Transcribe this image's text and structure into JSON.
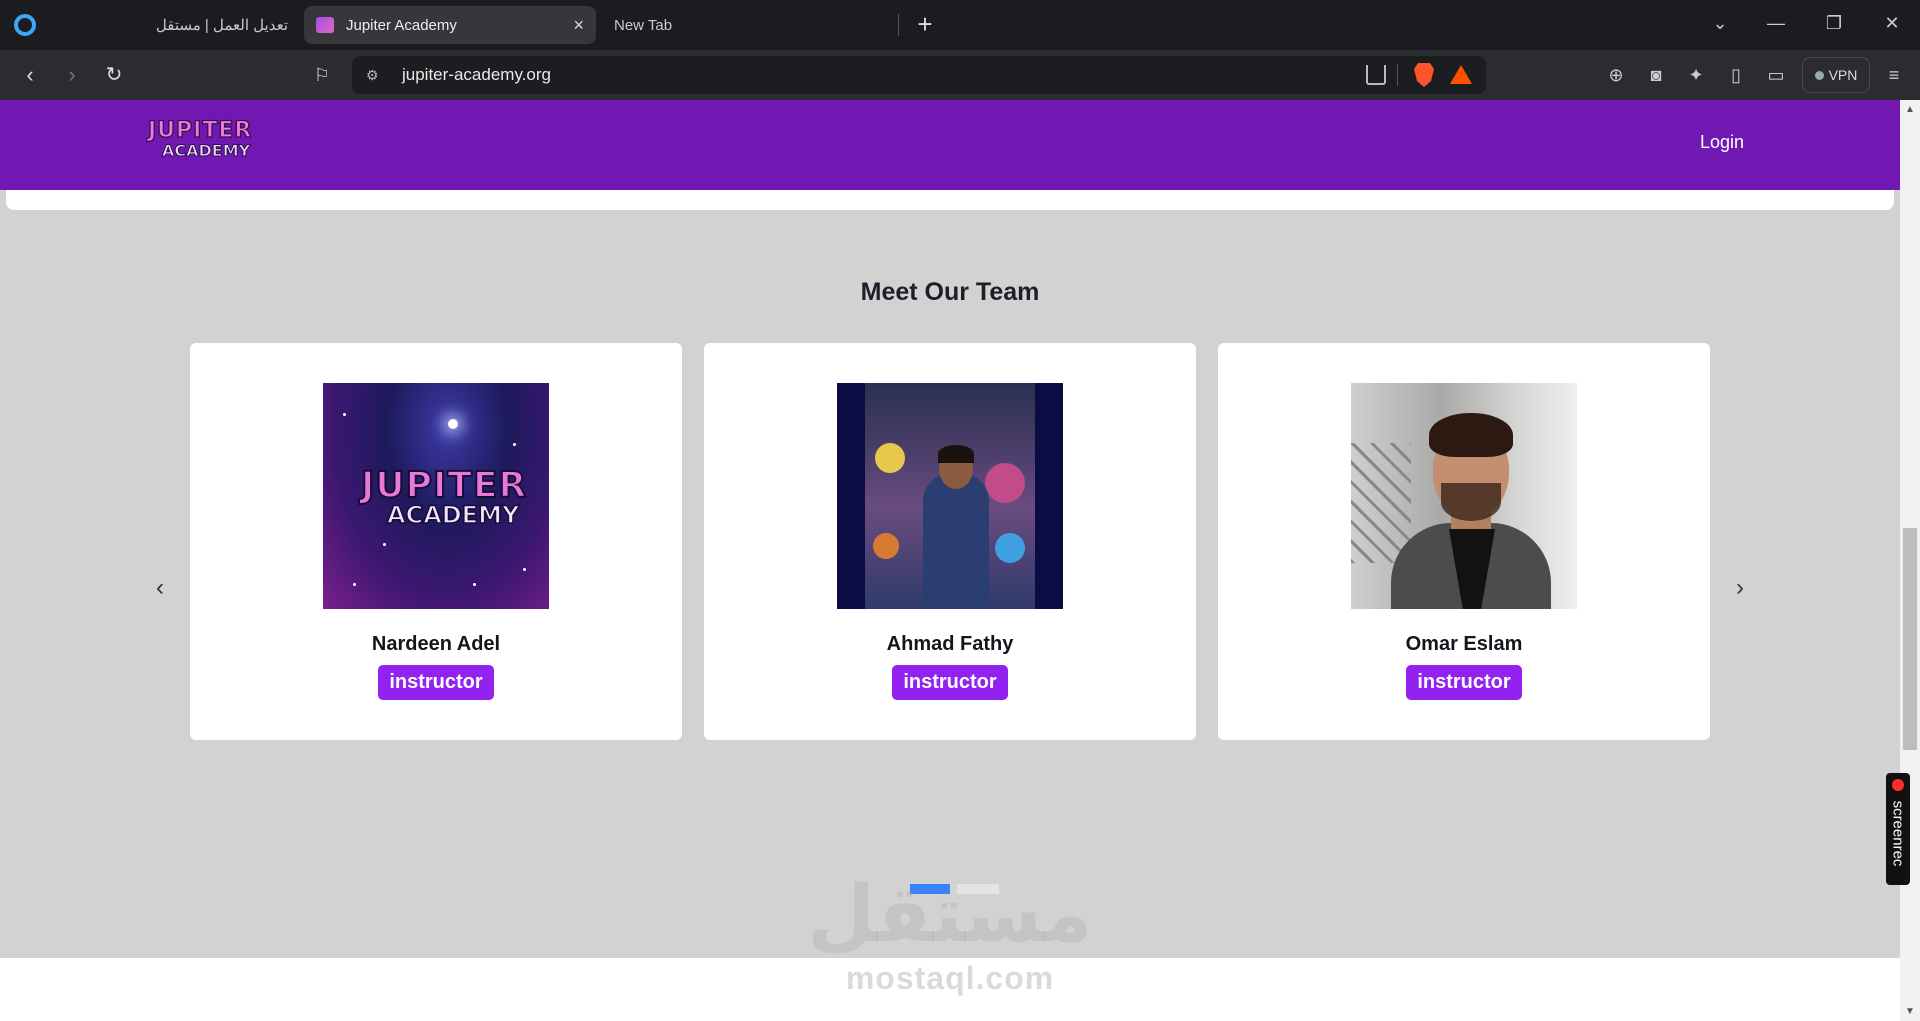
{
  "browser": {
    "tabs": [
      {
        "title": "تعديل العمل | مستقل"
      },
      {
        "title": "Jupiter Academy"
      },
      {
        "title": "New Tab"
      }
    ],
    "new_tab": "+",
    "close_tab": "×",
    "url": "jupiter-academy.org",
    "vpn_label": "VPN",
    "window_controls": {
      "minimize": "—",
      "maximize": "❐",
      "close": "✕",
      "tabsearch": "⌄"
    }
  },
  "site": {
    "logo_top": "JUPITER",
    "logo_bottom": "ACADEMY",
    "login_label": "Login"
  },
  "team": {
    "title": "Meet Our Team",
    "members": [
      {
        "name": "Nardeen Adel",
        "role": "instructor"
      },
      {
        "name": "Ahmad Fathy",
        "role": "instructor"
      },
      {
        "name": "Omar Eslam",
        "role": "instructor"
      }
    ],
    "prev_arrow": "‹",
    "next_arrow": "›"
  },
  "watermark": {
    "arabic": "مستقل",
    "latin": "mostaql.com"
  },
  "overlay": {
    "screenrec_label": "screenrec"
  },
  "colors": {
    "header": "#7118b3",
    "badge": "#9322f0",
    "indicator_active": "#3b82f6"
  }
}
